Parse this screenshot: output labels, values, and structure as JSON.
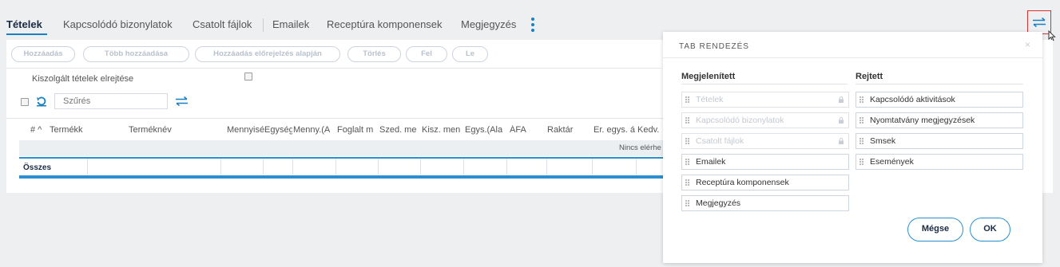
{
  "tabs": [
    {
      "label": "Tételek",
      "active": true
    },
    {
      "label": "Kapcsolódó bizonylatok"
    },
    {
      "label": "Csatolt fájlok"
    },
    {
      "label": "Emailek"
    },
    {
      "label": "Receptúra komponensek"
    },
    {
      "label": "Megjegyzés"
    }
  ],
  "toolbar": {
    "buttons": [
      "Hozzáadás",
      "Több hozzáadása",
      "Hozzáadás előrejelzés alapján",
      "Törlés",
      "Fel",
      "Le"
    ]
  },
  "options": {
    "hide_served_label": "Kiszolgált tételek elrejtése"
  },
  "filter": {
    "placeholder": "Szűrés"
  },
  "table": {
    "columns": [
      "# ^",
      "Termékk",
      "Terméknév",
      "Mennyisé",
      "Egység",
      "Menny.(A",
      "Foglalt m",
      "Szed. me",
      "Kisz. men",
      "Egys.(Ala",
      "ÁFA",
      "Raktár",
      "Er. egys. á",
      "Kedv."
    ],
    "empty_text": "Nincs elérhe",
    "summary_label": "Összes"
  },
  "modal": {
    "title": "TAB RENDEZÉS",
    "close": "×",
    "visible_header": "Megjelenített",
    "hidden_header": "Rejtett",
    "visible_items": [
      {
        "label": "Tételek",
        "locked": true
      },
      {
        "label": "Kapcsolódó bizonylatok",
        "locked": true
      },
      {
        "label": "Csatolt fájlok",
        "locked": true
      },
      {
        "label": "Emailek",
        "locked": false
      },
      {
        "label": "Receptúra komponensek",
        "locked": false
      },
      {
        "label": "Megjegyzés",
        "locked": false
      }
    ],
    "hidden_items": [
      {
        "label": "Kapcsolódó aktivitások"
      },
      {
        "label": "Nyomtatvány megjegyzések"
      },
      {
        "label": "Smsek"
      },
      {
        "label": "Események"
      }
    ],
    "cancel_label": "Mégse",
    "ok_label": "OK"
  },
  "colors": {
    "accent": "#1a80c4",
    "highlight_border": "#d9302b",
    "table_blue": "#2b8fd1"
  }
}
